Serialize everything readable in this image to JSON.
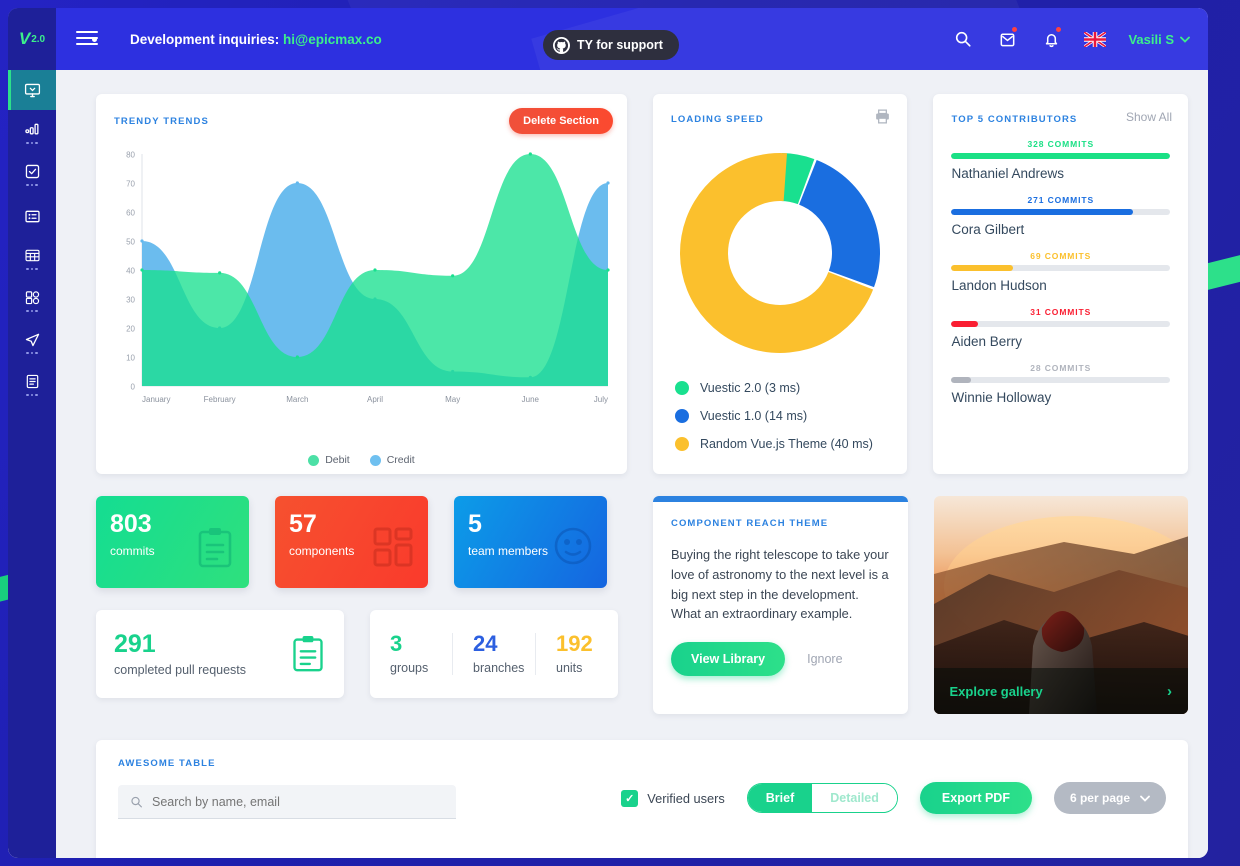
{
  "navbar": {
    "brand_letter": "V",
    "brand_version": "2.0",
    "dev_text": "Development inquiries:",
    "dev_email": "hi@epicmax.co",
    "github_label": "TY for support",
    "user_name": "Vasili S",
    "icons": [
      "search-icon",
      "mail-icon",
      "bell-icon",
      "flag-icon"
    ]
  },
  "sidebar": {
    "items": [
      {
        "name": "dashboard",
        "icon": "monitor-icon",
        "active": true
      },
      {
        "name": "statistics",
        "icon": "bar-chart-icon",
        "active": false
      },
      {
        "name": "forms",
        "icon": "checkbox-form-icon",
        "active": false
      },
      {
        "name": "cards",
        "icon": "cards-icon",
        "active": false
      },
      {
        "name": "tables",
        "icon": "table-grid-icon",
        "active": false
      },
      {
        "name": "ui-elements",
        "icon": "blocks-icon",
        "active": false
      },
      {
        "name": "maps",
        "icon": "paper-plane-icon",
        "active": false
      },
      {
        "name": "pages",
        "icon": "document-icon",
        "active": false
      }
    ]
  },
  "trendy_trends": {
    "title": "TRENDY TRENDS",
    "delete_button": "Delete Section"
  },
  "loading_speed": {
    "title": "LOADING SPEED",
    "print_icon": "printer-icon"
  },
  "contributors": {
    "title": "TOP 5 CONTRIBUTORS",
    "show_all": "Show All",
    "items": [
      {
        "count_label": "328 COMMITS",
        "name": "Nathaniel Andrews",
        "percent": 100,
        "color": "#1ae085"
      },
      {
        "count_label": "271 COMMITS",
        "name": "Cora Gilbert",
        "percent": 83,
        "color": "#1a6ee0"
      },
      {
        "count_label": "69 COMMITS",
        "name": "Landon Hudson",
        "percent": 28,
        "color": "#fbc02d"
      },
      {
        "count_label": "31 COMMITS",
        "name": "Aiden Berry",
        "percent": 12,
        "color": "#fa1e32"
      },
      {
        "count_label": "28 COMMITS",
        "name": "Winnie Holloway",
        "percent": 9,
        "color": "#b0b4bd"
      }
    ]
  },
  "stat_cards": [
    {
      "number": "803",
      "label": "commits",
      "icon": "clipboard-icon",
      "color_from": "#14dd92",
      "color_to": "#2fe07d"
    },
    {
      "number": "57",
      "label": "components",
      "icon": "blocks-icon",
      "color_from": "#f6512f",
      "color_to": "#fa3a2c"
    },
    {
      "number": "5",
      "label": "team members",
      "icon": "group-icon",
      "color_from": "#0c9ce8",
      "color_to": "#1565e0"
    }
  ],
  "pull_requests": {
    "number": "291",
    "label": "completed pull requests",
    "icon": "clipboard-icon"
  },
  "triple_stats": [
    {
      "number": "3",
      "label": "groups",
      "color": "#19d28c"
    },
    {
      "number": "24",
      "label": "branches",
      "color": "#2c5fe0"
    },
    {
      "number": "192",
      "label": "units",
      "color": "#fbc02d"
    }
  ],
  "reach_card": {
    "title": "COMPONENT REACH THEME",
    "text": "Buying the right telescope to take your love of astronomy to the next level is a big next step in the development. What an extraordinary example.",
    "primary_button": "View Library",
    "secondary_button": "Ignore"
  },
  "gallery": {
    "label": "Explore gallery",
    "chevron": "›"
  },
  "table_section": {
    "title": "AWESOME TABLE",
    "search_placeholder": "Search by name, email",
    "search_value": "",
    "checkbox_label": "Verified users",
    "checkbox_checked": true,
    "toggle_on": "Brief",
    "toggle_off": "Detailed",
    "export_button": "Export PDF",
    "per_page": "6 per page"
  },
  "chart_data": [
    {
      "type": "area",
      "title": "TRENDY TRENDS",
      "categories": [
        "January",
        "February",
        "March",
        "April",
        "May",
        "June",
        "July"
      ],
      "series": [
        {
          "name": "Debit",
          "color": "#19e08f",
          "values": [
            40,
            39,
            10,
            40,
            38,
            80,
            40
          ]
        },
        {
          "name": "Credit",
          "color": "#63b8ed",
          "values": [
            50,
            20,
            70,
            30,
            5,
            3,
            70
          ]
        }
      ],
      "ylim": [
        0,
        80
      ],
      "yticks": [
        0,
        10,
        20,
        30,
        40,
        50,
        60,
        70,
        80
      ],
      "xlabel": "",
      "ylabel": "",
      "grid": false,
      "legend_position": "bottom"
    },
    {
      "type": "pie",
      "title": "LOADING SPEED",
      "labels": [
        "Vuestic 2.0 (3 ms)",
        "Vuestic 1.0 (14 ms)",
        "Random Vue.js Theme (40 ms)"
      ],
      "values": [
        3,
        14,
        40
      ],
      "colors": [
        "#19e08f",
        "#1a6ee0",
        "#fbc02d"
      ],
      "donut": true,
      "legend_position": "bottom"
    },
    {
      "type": "bar",
      "title": "TOP 5 CONTRIBUTORS",
      "categories": [
        "Nathaniel Andrews",
        "Cora Gilbert",
        "Landon Hudson",
        "Aiden Berry",
        "Winnie Holloway"
      ],
      "values": [
        328,
        271,
        69,
        31,
        28
      ],
      "colors": [
        "#1ae085",
        "#1a6ee0",
        "#fbc02d",
        "#fa1e32",
        "#b0b4bd"
      ],
      "ylabel": "commits",
      "xlabel": ""
    }
  ]
}
